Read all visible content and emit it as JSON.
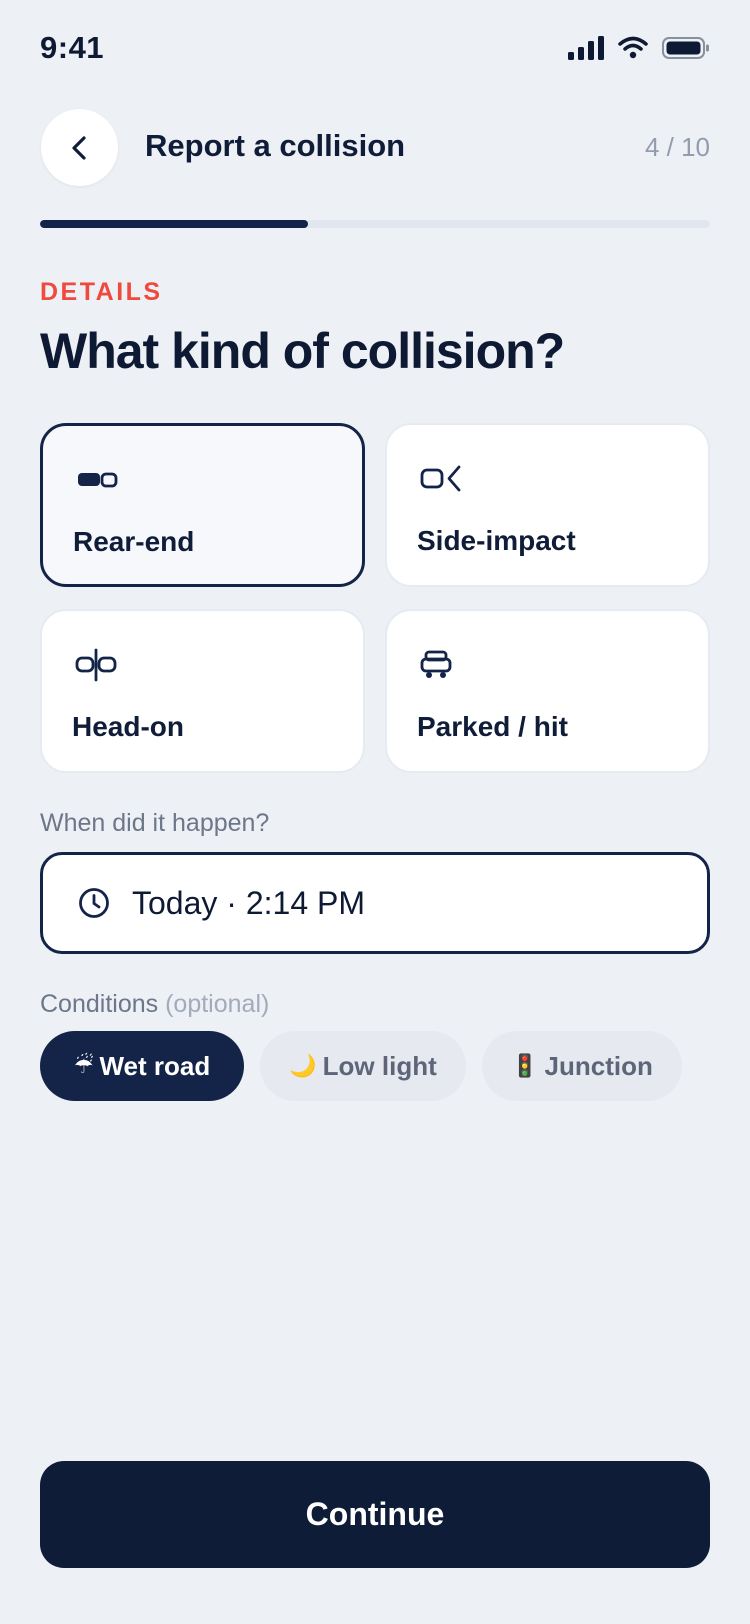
{
  "status_bar": {
    "time": "9:41"
  },
  "header": {
    "title": "Report a collision",
    "step": "4 / 10",
    "progress": 0.4
  },
  "section": {
    "eyebrow": "DETAILS",
    "title": "What kind of collision?"
  },
  "collision_types": [
    {
      "label": "Rear-end",
      "icon": "rear-end-icon",
      "selected": true
    },
    {
      "label": "Side-impact",
      "icon": "side-impact-icon",
      "selected": false
    },
    {
      "label": "Head-on",
      "icon": "head-on-icon",
      "selected": false
    },
    {
      "label": "Parked / hit",
      "icon": "parked-car-icon",
      "selected": false
    }
  ],
  "when": {
    "label": "When did it happen?",
    "value": "Today · 2:14 PM",
    "icon": "clock-icon"
  },
  "conditions": {
    "label": "Conditions",
    "optional": "(optional)",
    "chips": [
      {
        "label": "Wet road",
        "emoji": "☔",
        "active": true
      },
      {
        "label": "Low light",
        "emoji": "🌙",
        "active": false
      },
      {
        "label": "Junction",
        "emoji": "🚦",
        "active": false
      }
    ]
  },
  "footer": {
    "continue_label": "Continue"
  },
  "colors": {
    "navy": "#132448",
    "accent_red": "#F0493D",
    "background": "#EDF0F5"
  }
}
